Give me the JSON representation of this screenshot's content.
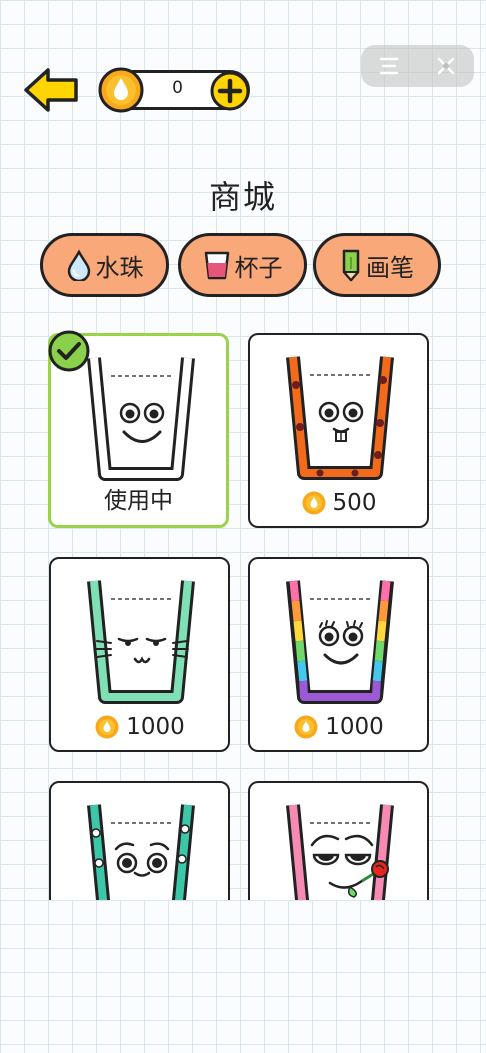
{
  "header": {
    "coin_count": "0",
    "title": "商城"
  },
  "tabs": [
    {
      "label": "水珠",
      "icon": "water-drop-icon"
    },
    {
      "label": "杯子",
      "icon": "cup-icon"
    },
    {
      "label": "画笔",
      "icon": "pencil-icon"
    }
  ],
  "items": [
    {
      "status": "使用中",
      "selected": true
    },
    {
      "price": "500"
    },
    {
      "price": "1000"
    },
    {
      "price": "1000"
    }
  ],
  "colors": {
    "tab_bg": "#f9a87a",
    "selected_border": "#9ad34a",
    "coin": "#f7a81b",
    "back_arrow": "#ffd400"
  }
}
